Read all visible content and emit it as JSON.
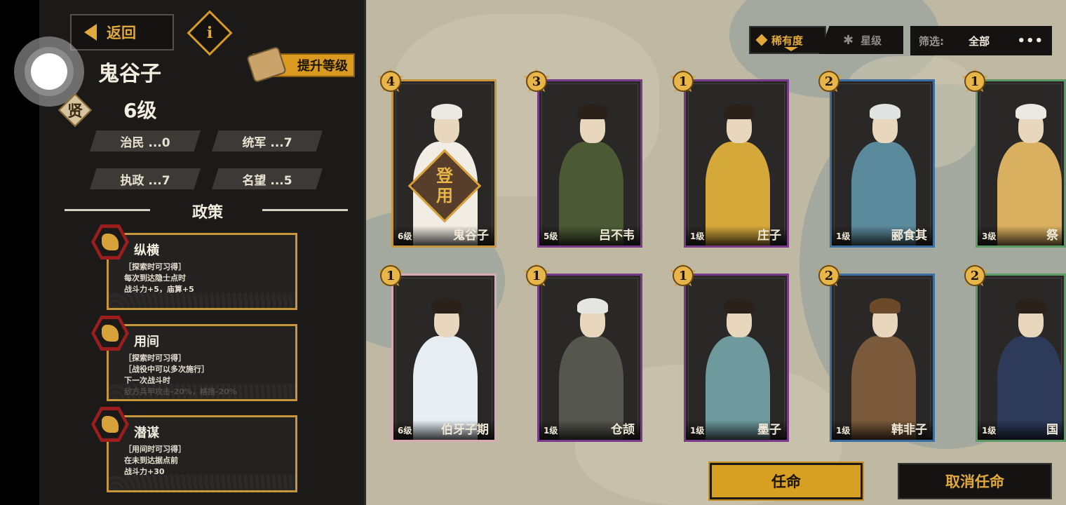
{
  "header": {
    "back_label": "返回",
    "info_label": "i",
    "upgrade_label": "提升等级"
  },
  "character": {
    "name": "鬼谷子",
    "rank": "贤",
    "level": "6级",
    "stats": [
      {
        "label": "治民 ...0"
      },
      {
        "label": "统军 ...7"
      },
      {
        "label": "执政 ...7"
      },
      {
        "label": "名望 ...5"
      }
    ]
  },
  "policy_section": {
    "title": "政策",
    "items": [
      {
        "name": "纵横",
        "desc": "［探索时可习得］\n每次到达隐士点时\n战斗力+5，庙算+5"
      },
      {
        "name": "用间",
        "desc": "［探索时可习得］\n［战役中可以多次施行］\n下一次战斗时\n敌方兵甲攻击-20%，格挡-20%"
      },
      {
        "name": "潜谋",
        "desc": "［用间时可习得］\n在未到达据点前\n战斗力+30"
      }
    ]
  },
  "sort": {
    "rarity_label": "稀有度",
    "star_label": "星级",
    "filter_label": "筛选:",
    "filter_value": "全部",
    "more_label": "•••"
  },
  "cards": [
    {
      "name": "鬼谷子",
      "level": "6级",
      "rarity": "4",
      "border": "#c8963a",
      "robe": "#f1ede4",
      "hair": "#ece9e2",
      "stamp": "登用"
    },
    {
      "name": "吕不韦",
      "level": "5级",
      "rarity": "3",
      "border": "#7a3a8c",
      "robe": "#4b5a34",
      "hair": "#2a211b"
    },
    {
      "name": "庄子",
      "level": "1级",
      "rarity": "1",
      "border": "#7a3a8c",
      "robe": "#d5a83a",
      "hair": "#2a211b"
    },
    {
      "name": "郦食其",
      "level": "1级",
      "rarity": "2",
      "border": "#3d6ea3",
      "robe": "#5b8a9c",
      "hair": "#dfe3e2"
    },
    {
      "name": "祭",
      "level": "3级",
      "rarity": "1",
      "border": "#5c9a66",
      "robe": "#d8b060",
      "hair": "#ece9e2"
    },
    {
      "name": "伯牙子期",
      "level": "6级",
      "rarity": "1",
      "border": "#d9a9b4",
      "robe": "#e6eef3",
      "hair": "#2a211b"
    },
    {
      "name": "仓颉",
      "level": "1级",
      "rarity": "1",
      "border": "#7a3a8c",
      "robe": "#55564d",
      "hair": "#e5e6e2"
    },
    {
      "name": "墨子",
      "level": "1级",
      "rarity": "1",
      "border": "#7a3a8c",
      "robe": "#6e9a9e",
      "hair": "#2a211b"
    },
    {
      "name": "韩非子",
      "level": "1级",
      "rarity": "2",
      "border": "#3d6ea3",
      "robe": "#7a5a3a",
      "hair": "#6b4a2a"
    },
    {
      "name": "国",
      "level": "1级",
      "rarity": "2",
      "border": "#5c9a66",
      "robe": "#2d3a5a",
      "hair": "#2a211b"
    }
  ],
  "actions": {
    "appoint_label": "任命",
    "cancel_label": "取消任命"
  }
}
